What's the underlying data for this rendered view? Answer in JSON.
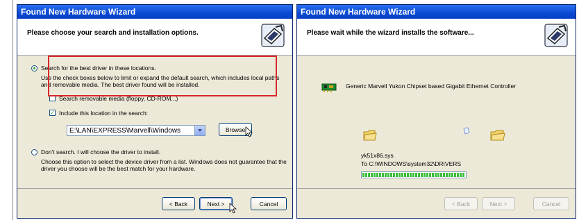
{
  "window1": {
    "title": "Found New Hardware Wizard",
    "header": "Please choose your search and installation options.",
    "option_search_label": "Search for the best driver in these locations.",
    "search_desc": "Use the check boxes below to limit or expand the default search, which includes local paths and removable media. The best driver found will be installed.",
    "check_removable_label": "Search removable media (floppy, CD-ROM...)",
    "check_include_label": "Include this location in the search:",
    "location_value": "E:\\LAN\\EXPRESS\\Marvell\\Windows",
    "browse_label": "Browse",
    "option_dont_search_label": "Don't search. I will choose the driver to install.",
    "dont_search_desc": "Choose this option to select the device driver from a list. Windows does not guarantee that the driver you choose will be the best match for your hardware.",
    "back_label": "< Back",
    "next_label": "Next >",
    "cancel_label": "Cancel"
  },
  "window2": {
    "title": "Found New Hardware Wizard",
    "header": "Please wait while the wizard installs the software...",
    "device_name": "Generic Marvell Yukon Chipset based Gigabit Ethernet Controller",
    "file_name": "yk51x86.sys",
    "destination": "To C:\\WINDOWS\\system32\\DRIVERS",
    "progress_segments": 37,
    "back_label": "< Back",
    "next_label": "Next >",
    "cancel_label": "Cancel"
  }
}
